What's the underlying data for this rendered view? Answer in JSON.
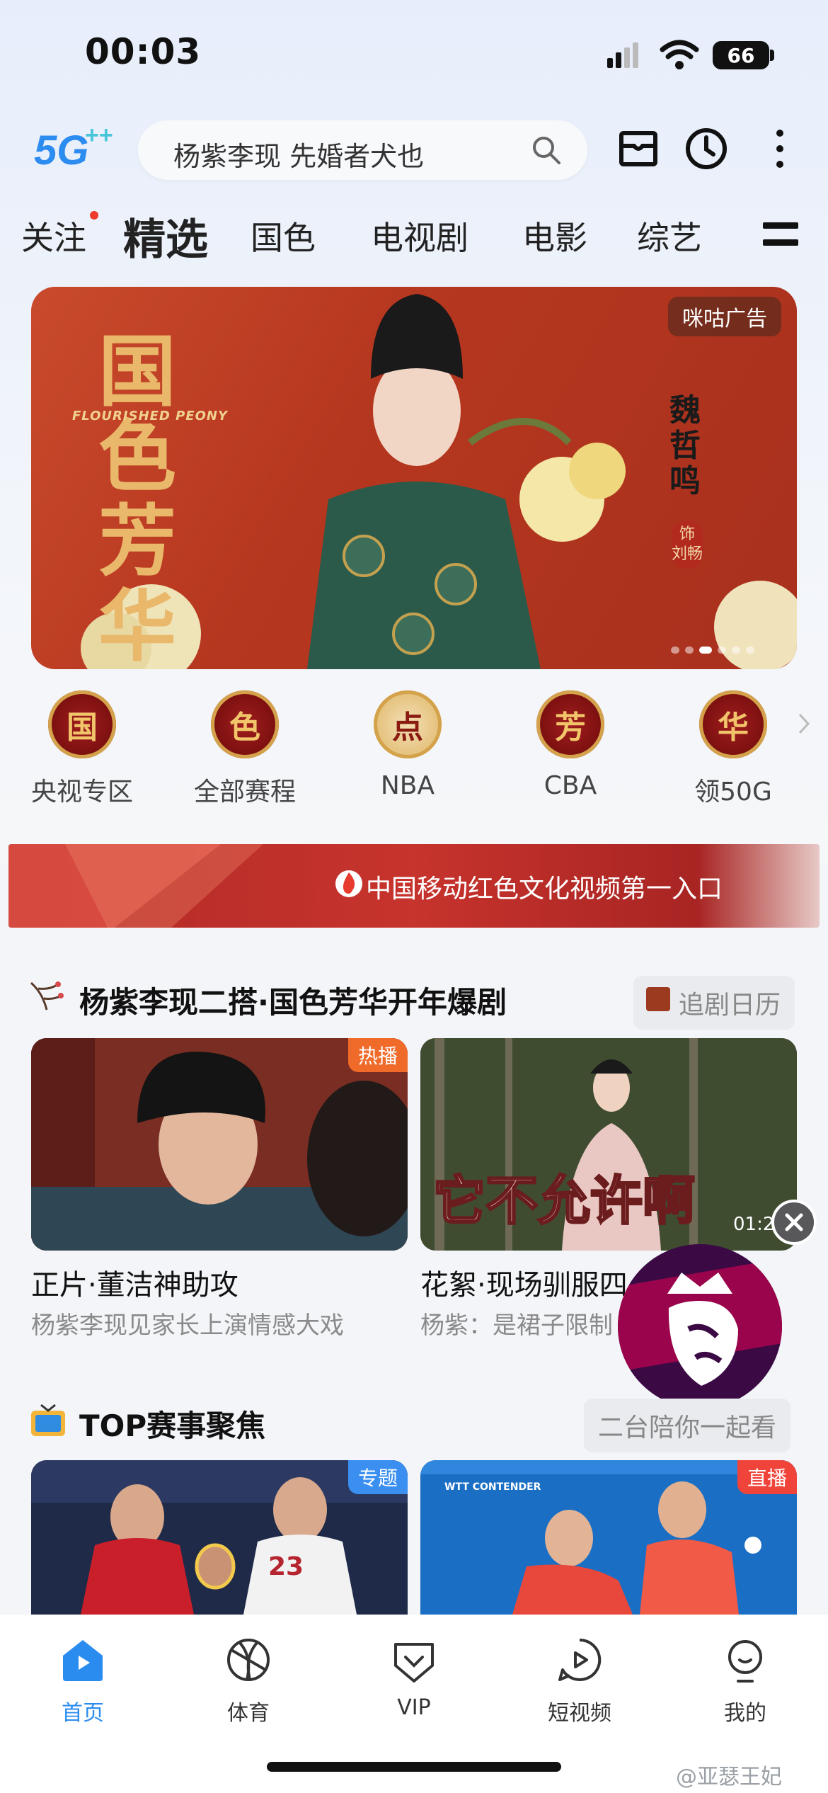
{
  "status": {
    "time": "00:03",
    "battery": "66"
  },
  "header": {
    "logo": "5G++",
    "search_text": "杨紫李现 先婚者犬也"
  },
  "tabs": [
    {
      "label": "关注"
    },
    {
      "label": "精选"
    },
    {
      "label": "国色"
    },
    {
      "label": "电视剧"
    },
    {
      "label": "电影"
    },
    {
      "label": "综艺"
    }
  ],
  "banner": {
    "title": "国色芳华",
    "subtitle": "FLOURISHED PEONY",
    "character": "魏哲鸣",
    "role": "饰 刘畅",
    "ad_label": "咪咕广告"
  },
  "categories": [
    {
      "badge": "国",
      "label": "央视专区"
    },
    {
      "badge": "色",
      "label": "全部赛程"
    },
    {
      "badge": "点",
      "label": "NBA"
    },
    {
      "badge": "芳",
      "label": "CBA"
    },
    {
      "badge": "华",
      "label": "领50G"
    }
  ],
  "promo": {
    "text": "中国移动红色文化视频第一入口"
  },
  "section1": {
    "title": "杨紫李现二搭·国色芳华开年爆剧",
    "pill": "追剧日历",
    "cards": [
      {
        "tag": "热播",
        "title": "正片·董洁神助攻",
        "subtitle": "杨紫李现见家长上演情感大戏"
      },
      {
        "overlay": "它不允许啊",
        "duration": "01:2",
        "title": "花絮·现场驯服四",
        "subtitle": "杨紫：是裙子限制"
      }
    ]
  },
  "section2": {
    "title": "TOP赛事聚焦",
    "pill": "二台陪你一起看",
    "cards": [
      {
        "tag": "专题",
        "jersey": "23"
      },
      {
        "tag": "直播",
        "brand": "WTT CONTENDER"
      }
    ]
  },
  "nav": [
    {
      "label": "首页",
      "icon": "home-play-icon",
      "active": true
    },
    {
      "label": "体育",
      "icon": "basketball-icon"
    },
    {
      "label": "VIP",
      "icon": "vip-icon"
    },
    {
      "label": "短视频",
      "icon": "short-video-icon"
    },
    {
      "label": "我的",
      "icon": "profile-icon"
    }
  ],
  "watermark": "@亚瑟王妃",
  "colors": {
    "accent": "#2b8cf0",
    "brand_red": "#b6371f",
    "tag_orange": "#f06a2a",
    "tag_blue": "#3a8ff0"
  }
}
